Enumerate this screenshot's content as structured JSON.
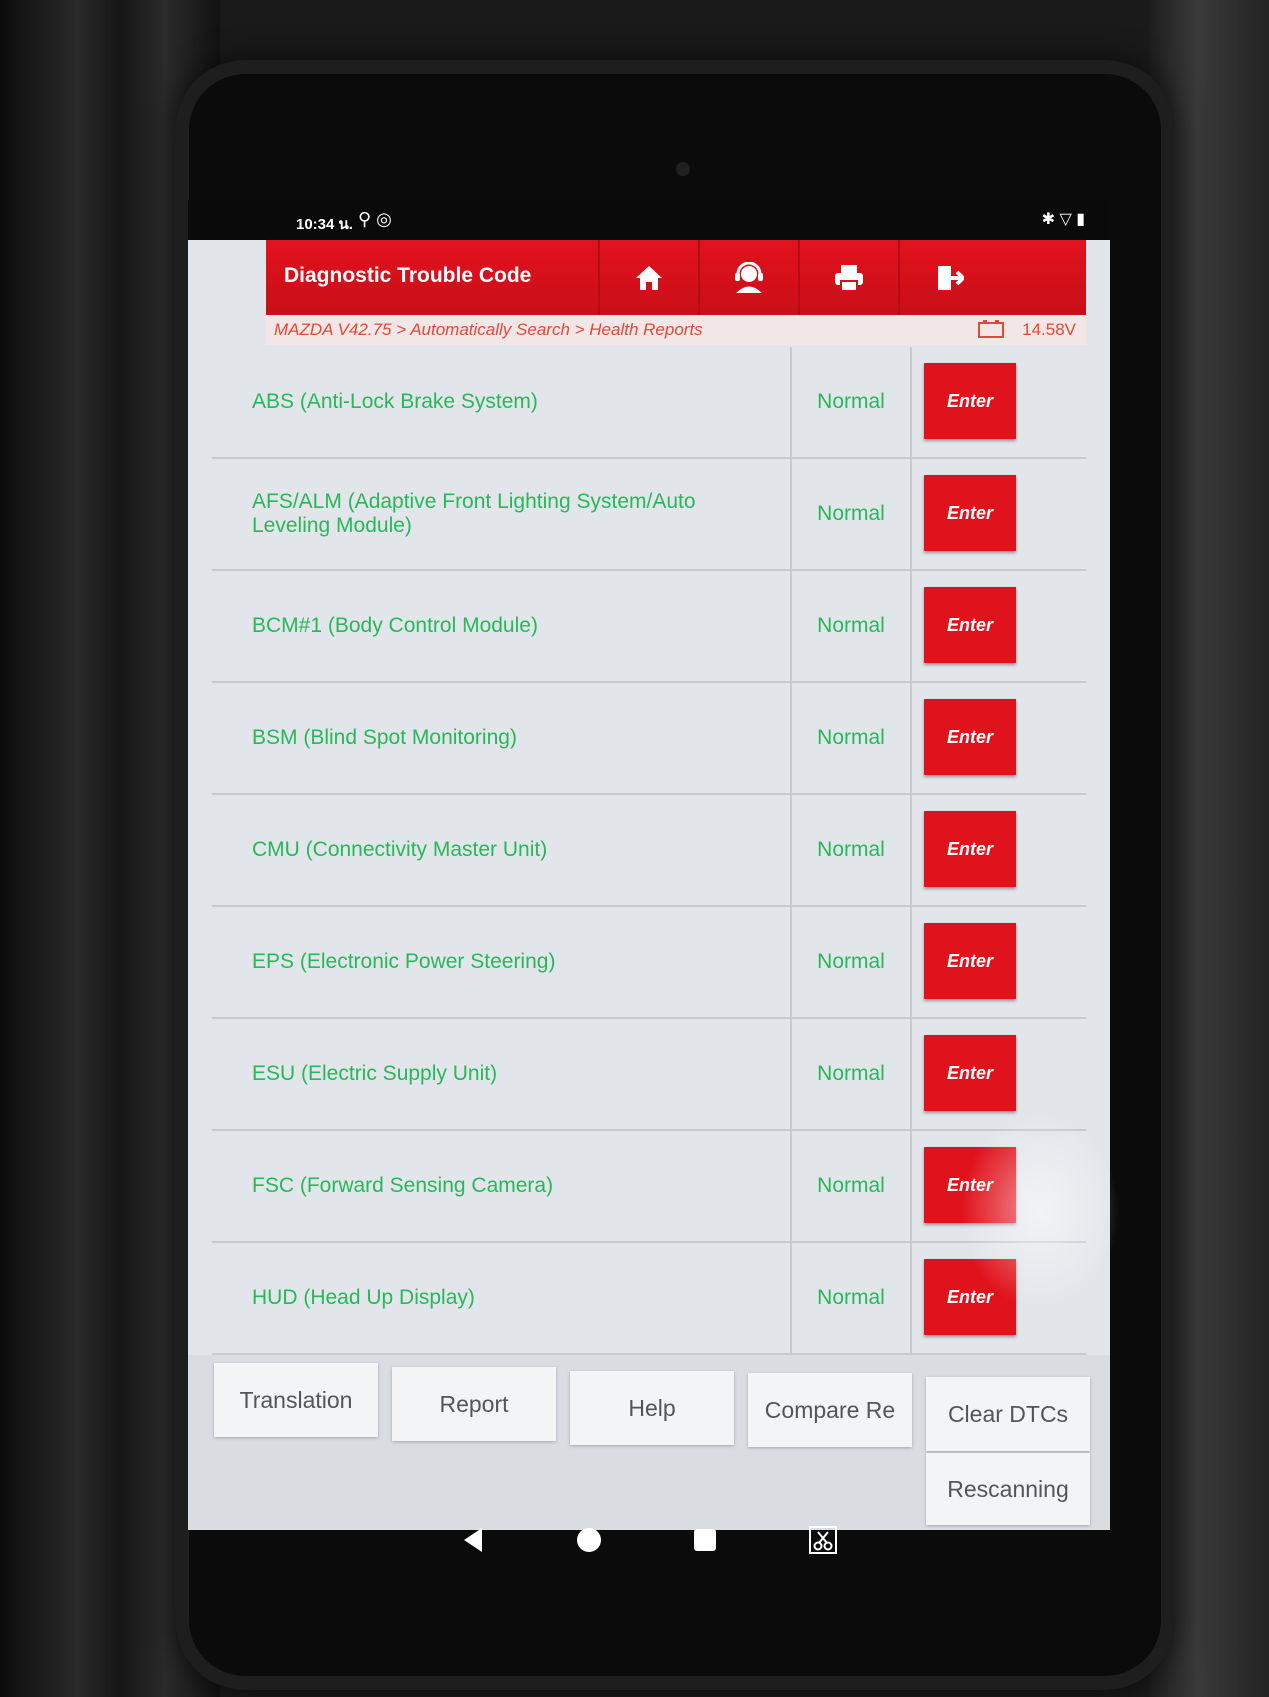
{
  "status_bar": {
    "time": "10:34 น."
  },
  "header": {
    "title": "Diagnostic Trouble Code"
  },
  "breadcrumb": {
    "path": "MAZDA V42.75 > Automatically Search > Health Reports",
    "voltage": "14.58V"
  },
  "systems": [
    {
      "name": "ABS (Anti-Lock Brake System)",
      "status": "Normal",
      "action": "Enter"
    },
    {
      "name": "AFS/ALM (Adaptive Front Lighting System/Auto Leveling Module)",
      "status": "Normal",
      "action": "Enter"
    },
    {
      "name": "BCM#1 (Body Control Module)",
      "status": "Normal",
      "action": "Enter"
    },
    {
      "name": "BSM (Blind Spot Monitoring)",
      "status": "Normal",
      "action": "Enter"
    },
    {
      "name": "CMU (Connectivity Master Unit)",
      "status": "Normal",
      "action": "Enter"
    },
    {
      "name": "EPS (Electronic Power Steering)",
      "status": "Normal",
      "action": "Enter"
    },
    {
      "name": "ESU (Electric Supply Unit)",
      "status": "Normal",
      "action": "Enter"
    },
    {
      "name": "FSC (Forward Sensing Camera)",
      "status": "Normal",
      "action": "Enter"
    },
    {
      "name": "HUD (Head Up Display)",
      "status": "Normal",
      "action": "Enter"
    }
  ],
  "actions": {
    "translation": "Translation",
    "report": "Report",
    "help": "Help",
    "compare": "Compare Re",
    "clear_dtcs": "Clear DTCs",
    "rescanning": "Rescanning"
  },
  "colors": {
    "accent": "#e0121c",
    "ok_text": "#28b85a",
    "breadcrumb_text": "#e04a38"
  }
}
